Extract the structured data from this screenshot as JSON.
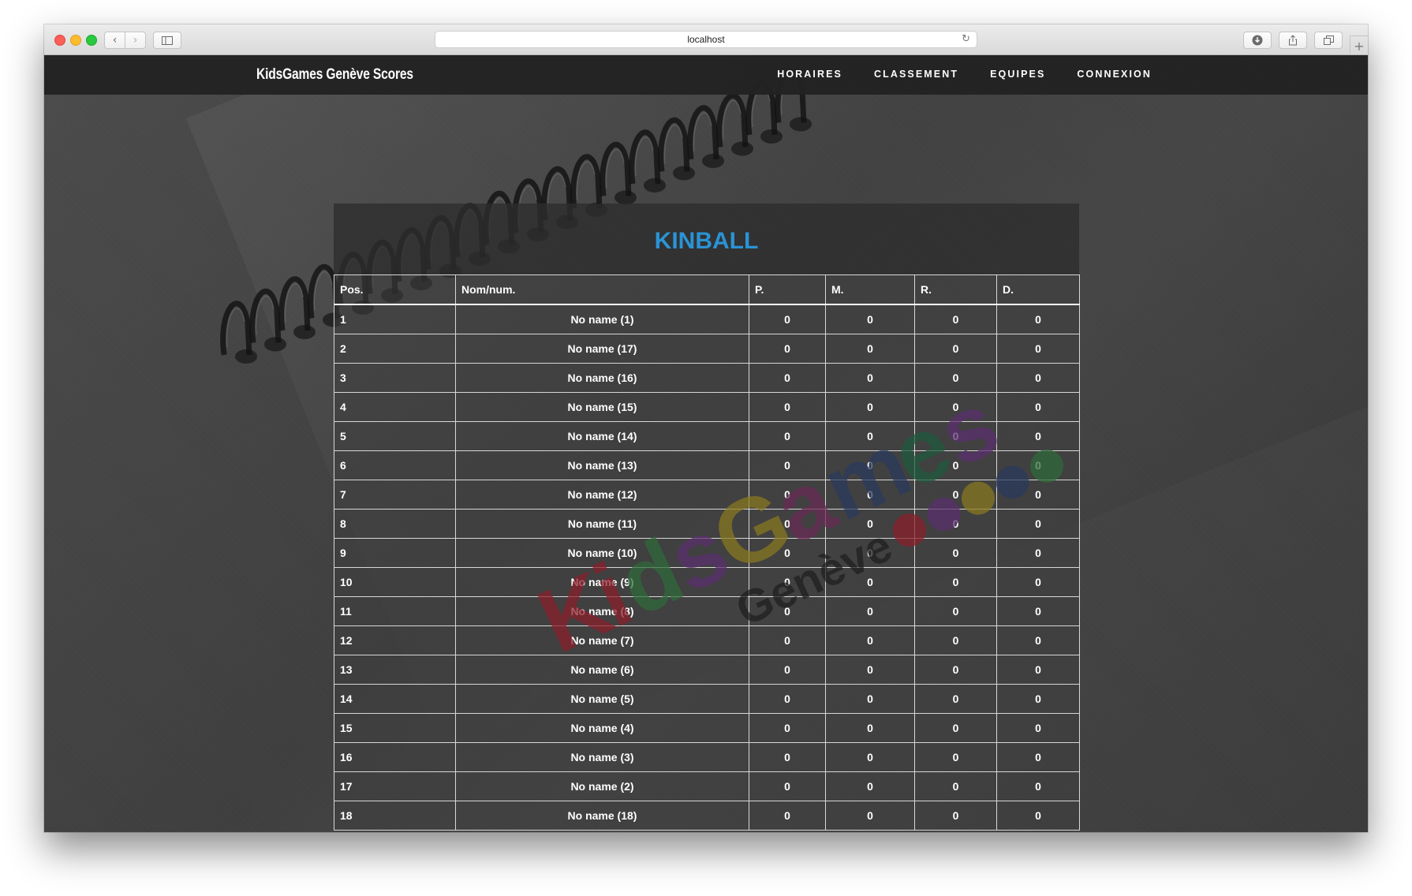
{
  "browser": {
    "url": "localhost"
  },
  "navbar": {
    "brand": "KidsGames Genève Scores",
    "links": [
      "HORAIRES",
      "CLASSEMENT",
      "EQUIPES",
      "CONNEXION"
    ]
  },
  "ranking": {
    "title": "KINBALL",
    "headers": [
      "Pos.",
      "Nom/num.",
      "P.",
      "M.",
      "R.",
      "D."
    ],
    "rows": [
      [
        "1",
        "No name (1)",
        "0",
        "0",
        "0",
        "0"
      ],
      [
        "2",
        "No name (17)",
        "0",
        "0",
        "0",
        "0"
      ],
      [
        "3",
        "No name (16)",
        "0",
        "0",
        "0",
        "0"
      ],
      [
        "4",
        "No name (15)",
        "0",
        "0",
        "0",
        "0"
      ],
      [
        "5",
        "No name (14)",
        "0",
        "0",
        "0",
        "0"
      ],
      [
        "6",
        "No name (13)",
        "0",
        "0",
        "0",
        "0"
      ],
      [
        "7",
        "No name (12)",
        "0",
        "0",
        "0",
        "0"
      ],
      [
        "8",
        "No name (11)",
        "0",
        "0",
        "0",
        "0"
      ],
      [
        "9",
        "No name (10)",
        "0",
        "0",
        "0",
        "0"
      ],
      [
        "10",
        "No name (9)",
        "0",
        "0",
        "0",
        "0"
      ],
      [
        "11",
        "No name (8)",
        "0",
        "0",
        "0",
        "0"
      ],
      [
        "12",
        "No name (7)",
        "0",
        "0",
        "0",
        "0"
      ],
      [
        "13",
        "No name (6)",
        "0",
        "0",
        "0",
        "0"
      ],
      [
        "14",
        "No name (5)",
        "0",
        "0",
        "0",
        "0"
      ],
      [
        "15",
        "No name (4)",
        "0",
        "0",
        "0",
        "0"
      ],
      [
        "16",
        "No name (3)",
        "0",
        "0",
        "0",
        "0"
      ],
      [
        "17",
        "No name (2)",
        "0",
        "0",
        "0",
        "0"
      ],
      [
        "18",
        "No name (18)",
        "0",
        "0",
        "0",
        "0"
      ]
    ]
  },
  "watermark": {
    "logo_text": "KidsGames",
    "logo_subtext": "Genève",
    "colors": [
      "#8b1e2a",
      "#2f6b3a",
      "#5a2f6e",
      "#8a7a20",
      "#6a2a55",
      "#2a3a5e",
      "#1e5a3e"
    ]
  },
  "icons": [
    "back-icon",
    "forward-icon",
    "sidebar-icon",
    "reload-icon",
    "download-icon",
    "share-icon",
    "tabs-icon",
    "new-tab-icon"
  ]
}
